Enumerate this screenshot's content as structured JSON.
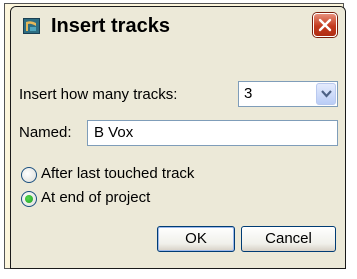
{
  "dialog": {
    "title": "Insert tracks",
    "count_label": "Insert how many tracks:",
    "count_value": "3",
    "named_label": "Named:",
    "named_value": "B Vox",
    "options": [
      {
        "label": "After last touched track",
        "selected": false
      },
      {
        "label": "At end of project",
        "selected": true
      }
    ],
    "ok_label": "OK",
    "cancel_label": "Cancel"
  },
  "icons": {
    "app": "reaper-app-icon",
    "close": "close-icon",
    "dropdown": "chevron-down-icon"
  },
  "colors": {
    "window_bg": "#ece9d8",
    "close_red": "#c4391d",
    "field_border": "#7f9db9",
    "radio_dot": "#21a121",
    "frame_bg": "#fdf6dc"
  }
}
